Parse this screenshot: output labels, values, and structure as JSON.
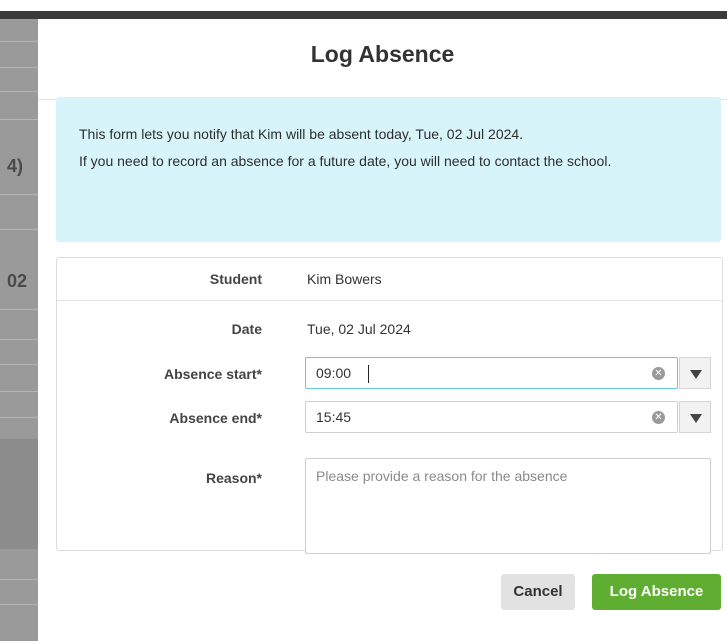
{
  "background": {
    "fragment_1": "4)",
    "fragment_2": "02"
  },
  "modal": {
    "title": "Log Absence",
    "info": {
      "line1": "This form lets you notify that Kim will be absent today, Tue, 02 Jul 2024.",
      "line2": "If you need to record an absence for a future date, you will need to contact the school."
    },
    "form": {
      "student_label": "Student",
      "student_value": "Kim Bowers",
      "date_label": "Date",
      "date_value": "Tue, 02 Jul 2024",
      "absence_start_label": "Absence start*",
      "absence_start_value": "09:00",
      "absence_end_label": "Absence end*",
      "absence_end_value": "15:45",
      "reason_label": "Reason*",
      "reason_placeholder": "Please provide a reason for the absence"
    },
    "buttons": {
      "cancel": "Cancel",
      "submit": "Log Absence"
    }
  },
  "colors": {
    "info_bg": "#d8f4fb",
    "primary": "#5fae31",
    "focus_border": "#66c9de"
  }
}
